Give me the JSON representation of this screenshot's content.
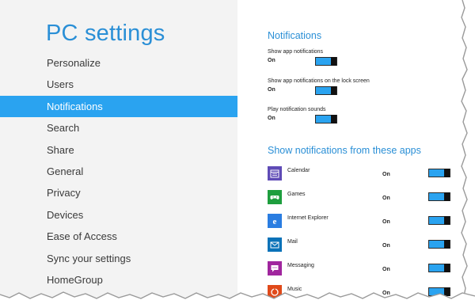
{
  "left": {
    "title": "PC settings",
    "nav": [
      {
        "label": "Personalize",
        "selected": false
      },
      {
        "label": "Users",
        "selected": false
      },
      {
        "label": "Notifications",
        "selected": true
      },
      {
        "label": "Search",
        "selected": false
      },
      {
        "label": "Share",
        "selected": false
      },
      {
        "label": "General",
        "selected": false
      },
      {
        "label": "Privacy",
        "selected": false
      },
      {
        "label": "Devices",
        "selected": false
      },
      {
        "label": "Ease of Access",
        "selected": false
      },
      {
        "label": "Sync your settings",
        "selected": false
      },
      {
        "label": "HomeGroup",
        "selected": false
      }
    ]
  },
  "right": {
    "section_title": "Notifications",
    "settings": [
      {
        "label": "Show app notifications",
        "state": "On"
      },
      {
        "label": "Show app notifications on the lock screen",
        "state": "On"
      },
      {
        "label": "Play notification sounds",
        "state": "On"
      }
    ],
    "apps_title": "Show notifications from these apps",
    "apps": [
      {
        "name": "Calendar",
        "state": "On",
        "icon": "calendar-icon",
        "color": "#5f4bb6"
      },
      {
        "name": "Games",
        "state": "On",
        "icon": "games-icon",
        "color": "#1e9e3e"
      },
      {
        "name": "Internet Explorer",
        "state": "On",
        "icon": "internet-explorer-icon",
        "color": "#2a7de1"
      },
      {
        "name": "Mail",
        "state": "On",
        "icon": "mail-icon",
        "color": "#0a72b8"
      },
      {
        "name": "Messaging",
        "state": "On",
        "icon": "messaging-icon",
        "color": "#a0269e"
      },
      {
        "name": "Music",
        "state": "On",
        "icon": "music-icon",
        "color": "#e04a1a"
      }
    ]
  },
  "colors": {
    "accent": "#2aa3f0",
    "title_blue": "#2a8fd6",
    "left_bg": "#f3f3f3"
  }
}
